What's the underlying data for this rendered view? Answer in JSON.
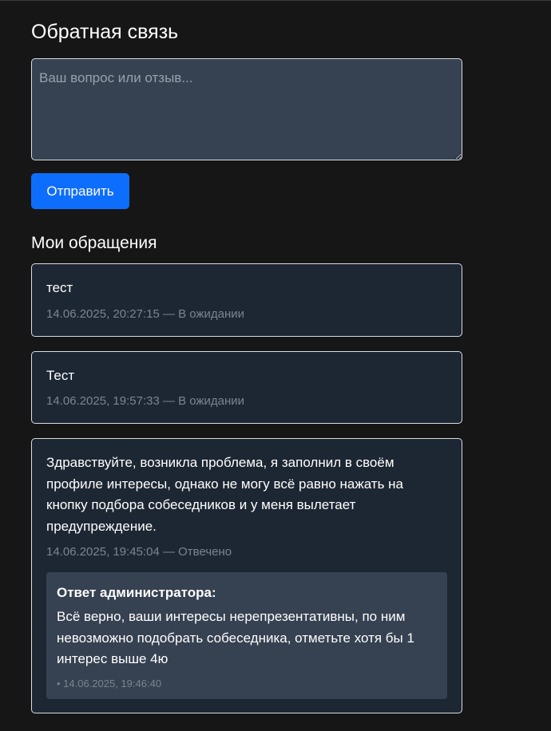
{
  "feedback": {
    "title": "Обратная связь",
    "input_placeholder": "Ваш вопрос или отзыв...",
    "input_value": "",
    "submit_label": "Отправить"
  },
  "my_tickets": {
    "title": "Мои обращения",
    "items": [
      {
        "text": "тест",
        "meta": "14.06.2025, 20:27:15 — В ожидании"
      },
      {
        "text": "Тест",
        "meta": "14.06.2025, 19:57:33 — В ожидании"
      },
      {
        "text": "Здравствуйте, возникла проблема, я заполнил в своём профиле интересы, однако не могу всё равно нажать на кнопку подбора собеседников и у меня вылетает предупреждение.",
        "meta": "14.06.2025, 19:45:04 — Отвечено",
        "reply": {
          "title": "Ответ администратора:",
          "text": "Всё верно, ваши интересы нерепрезентативны, по ним невозможно подобрать собеседника, отметьте хотя бы 1 интерес выше 4ю",
          "meta": "• 14.06.2025, 19:46:40"
        }
      }
    ]
  },
  "colors": {
    "background": "#161616",
    "card": "#1d2733",
    "input": "#364151",
    "primary": "#0d6efd",
    "muted": "#7b8591"
  }
}
